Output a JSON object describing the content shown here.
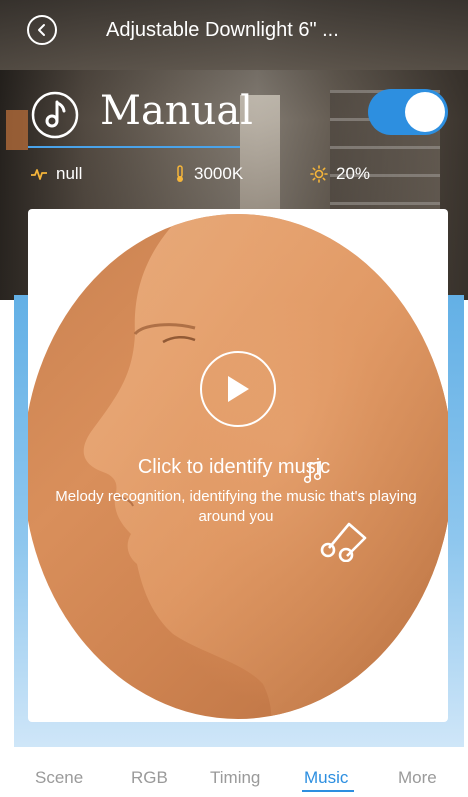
{
  "header": {
    "title": "Adjustable Downlight 6\" ..."
  },
  "mode": {
    "label": "Manual",
    "toggle_on": true
  },
  "status": {
    "effect": "null",
    "color_temp": "3000K",
    "brightness": "20%"
  },
  "music": {
    "title": "Click to identify music",
    "subtitle": "Melody recognition, identifying the music that's playing around you"
  },
  "tabs": [
    {
      "label": "Scene",
      "active": false
    },
    {
      "label": "RGB",
      "active": false
    },
    {
      "label": "Timing",
      "active": false
    },
    {
      "label": "Music",
      "active": true
    },
    {
      "label": "More",
      "active": false
    }
  ],
  "colors": {
    "accent": "#2d8fe0",
    "tab_inactive": "#9a9a9a",
    "status_icon": "#f5b53a"
  },
  "icons": {
    "back": "chevron-left-icon",
    "mode": "music-note-icon",
    "effect": "pulse-icon",
    "color_temp": "thermometer-icon",
    "brightness": "sun-icon",
    "play": "play-icon"
  }
}
